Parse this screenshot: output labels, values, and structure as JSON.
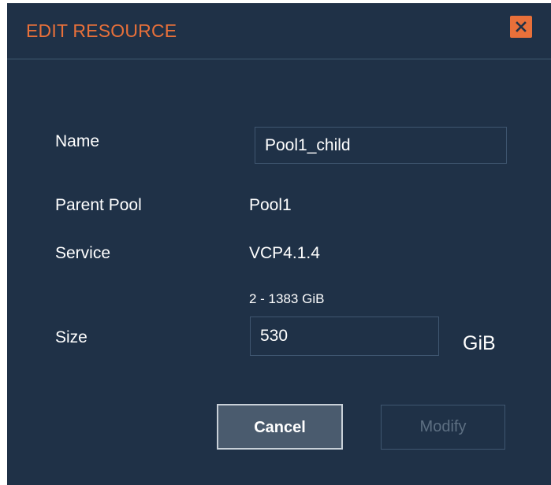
{
  "dialog": {
    "title": "EDIT RESOURCE",
    "close_icon": "close-icon",
    "accent_color": "#e8703a",
    "background_color": "#1f3147"
  },
  "form": {
    "name_label": "Name",
    "name_value": "Pool1_child",
    "parent_pool_label": "Parent Pool",
    "parent_pool_value": "Pool1",
    "service_label": "Service",
    "service_value": "VCP4.1.4",
    "size_range_hint": "2 - 1383 GiB",
    "size_label": "Size",
    "size_value": "530",
    "size_unit": "GiB"
  },
  "buttons": {
    "cancel_label": "Cancel",
    "modify_label": "Modify",
    "modify_enabled": false
  }
}
